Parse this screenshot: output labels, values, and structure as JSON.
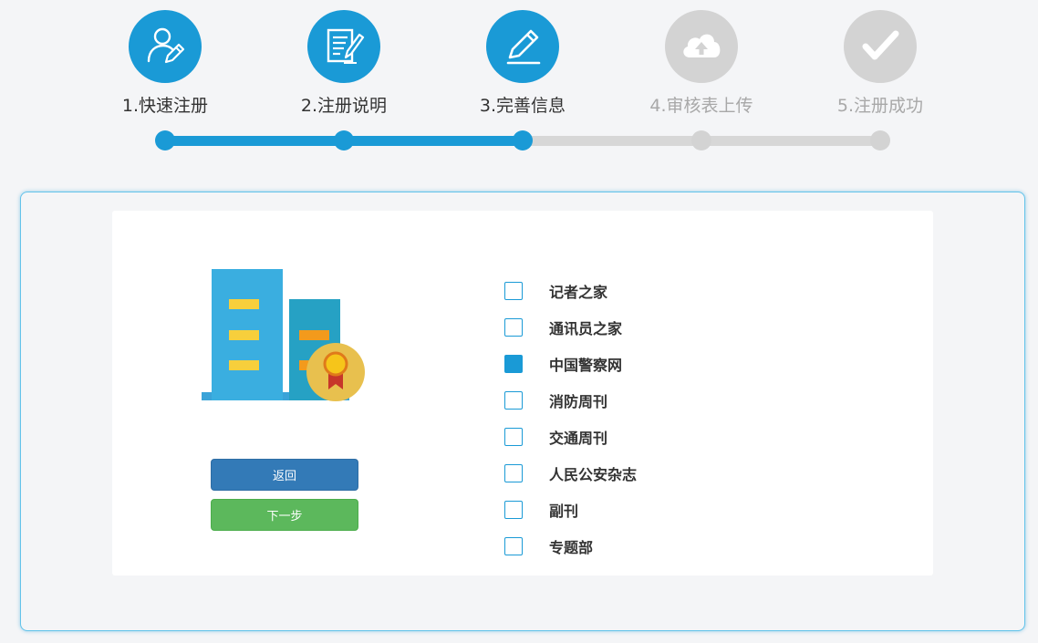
{
  "steps": [
    {
      "label": "1.快速注册",
      "icon": "user-edit-icon",
      "state": "active"
    },
    {
      "label": "2.注册说明",
      "icon": "document-edit-icon",
      "state": "active"
    },
    {
      "label": "3.完善信息",
      "icon": "pencil-icon",
      "state": "active"
    },
    {
      "label": "4.审核表上传",
      "icon": "cloud-upload-icon",
      "state": "inactive"
    },
    {
      "label": "5.注册成功",
      "icon": "checkmark-icon",
      "state": "inactive"
    }
  ],
  "progress": {
    "completed_steps": 3,
    "total_steps": 5
  },
  "buttons": {
    "back_label": "返回",
    "next_label": "下一步"
  },
  "options": [
    {
      "label": "记者之家",
      "checked": false
    },
    {
      "label": "通讯员之家",
      "checked": false
    },
    {
      "label": "中国警察网",
      "checked": true
    },
    {
      "label": "消防周刊",
      "checked": false
    },
    {
      "label": "交通周刊",
      "checked": false
    },
    {
      "label": "人民公安杂志",
      "checked": false
    },
    {
      "label": "副刊",
      "checked": false
    },
    {
      "label": "专题部",
      "checked": false
    }
  ],
  "colors": {
    "accent": "#1a9ad6",
    "inactive": "#d3d3d3",
    "back_button": "#337ab7",
    "next_button": "#5cb85c"
  }
}
